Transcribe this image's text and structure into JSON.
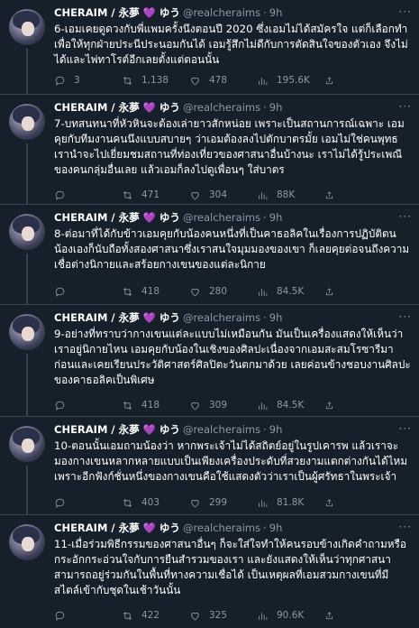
{
  "tweets": [
    {
      "name": "CHERAIM / 永夢 💜 ゆう",
      "handle": "@realcheraims",
      "time": "9h",
      "text": "6-เอมเคยดูดวงกับพี่แพมครั้งนึงตอนปี 2020 ซึ่งเอมไม่ได้สมัครใจ แต่ก็เลือกทำเพื่อให้ทุกฝ่ายประนีประนอมกันได้ เอมรู้สึกไม่ดีกับการตัดสินใจของตัวเอง จึงไม่ได้และไพ่ทาโรต์อีกเลยตั้งแต่ตอนนั้น",
      "replies": "3",
      "retweets": "1,138",
      "likes": "478",
      "views": "195.6K"
    },
    {
      "name": "CHERAIM / 永夢 💜 ゆう",
      "handle": "@realcheraims",
      "time": "9h",
      "text": "7-บทสนทนาที่หัวหินจะต้องเล่ายาวสักหน่อย เพราะเป็นสถานการณ์เฉพาะ เอมคุยกับทีมงานคนนึงแบบสบายๆ ว่าเอมต้องลงไปตักบาตรมั้ย เอมไม่ใช่คนพุทธ เรานำจะไปเยี่ยมชมสถานที่ท่องเที่ยวของศาสนาอื่นบ้างนะ เราไม่ได้รู้ประเพณีของคนกลุ่มอื่นเลย แล้วเอมก็ลงไปดูเพื่อนๆ ใส่บาตร",
      "replies": "",
      "retweets": "471",
      "likes": "304",
      "views": "88K"
    },
    {
      "name": "CHERAIM / 永夢 💜 ゆう",
      "handle": "@realcheraims",
      "time": "9h",
      "text": "8-ต่อมาที่ได้กับข้าวเอมคุยกับน้องคนหนึ่งที่เป็นคาธอลิคในเรื่องการปฏิบัติตน น้องเองก็นับถือทั้งสองศาสนาซึ่งเราสนใจมุมมองของเขา ก็เลยคุยต่อจนถึงความเชื่อต่างนิกายและสร้อยกางเขนของแต่ละนิกาย",
      "replies": "",
      "retweets": "418",
      "likes": "280",
      "views": "84.5K"
    },
    {
      "name": "CHERAIM / 永夢 💜 ゆう",
      "handle": "@realcheraims",
      "time": "9h",
      "text": "9-อย่างที่ทราบว่ากางเขนแต่ละแบบไม่เหมือนกัน มันเป็นเครื่องแสดงให้เห็นว่าเราอยู่นิกายไหน เอมคุยกับน้องในเชิงของศิลปะเนื่องจากเอมสะสมโรซารีมาก่อนและเคยเรียนประวัติศาสตร์ศิลปิตะวันตกมาด้วย เลยค่อนข้างชอบงานศิลปะของคาธอลิคเป็นพิเศษ",
      "replies": "",
      "retweets": "418",
      "likes": "309",
      "views": "84.5K"
    },
    {
      "name": "CHERAIM / 永夢 💜 ゆう",
      "handle": "@realcheraims",
      "time": "9h",
      "text": "10-ตอนนั้นเอมถามน้องว่า หากพระเจ้าไม่ได้สถิตย์อยู่ในรูปเคารพ แล้วเราจะมองกางเขนหลากหลายแบบเป็นเพียงเครื่องประดับที่สวยงามแตกต่างกันได้ไหม เพราะอีกฟังก์ชั่นหนึ่งของกางเขนคือใช้แสดงตัวว่าเราเป็นผู้ศรัทธาในพระเจ้า",
      "replies": "",
      "retweets": "403",
      "likes": "299",
      "views": "81.8K"
    },
    {
      "name": "CHERAIM / 永夢 💜 ゆう",
      "handle": "@realcheraims",
      "time": "9h",
      "text": "11-เมื่อร่วมพิธีกรรมของศาสนาอื่นๆ ก็จะใส่ใจทำให้คนรอบข้างเกิดคำถามหรือกระอักกระอ่วนใจกับการยืนสำรวมของเรา และยังแสดงให้เห็นว่าทุกศาสนาสามารถอยู่ร่วมกันในพื้นที่ทางความเชื่อได้ เป็นเหตุผลที่เอมสวมกางเขนที่มีสไตล์เข้ากับชุดในเช้าวันนั้น",
      "replies": "",
      "retweets": "422",
      "likes": "325",
      "views": "90.6K"
    }
  ]
}
